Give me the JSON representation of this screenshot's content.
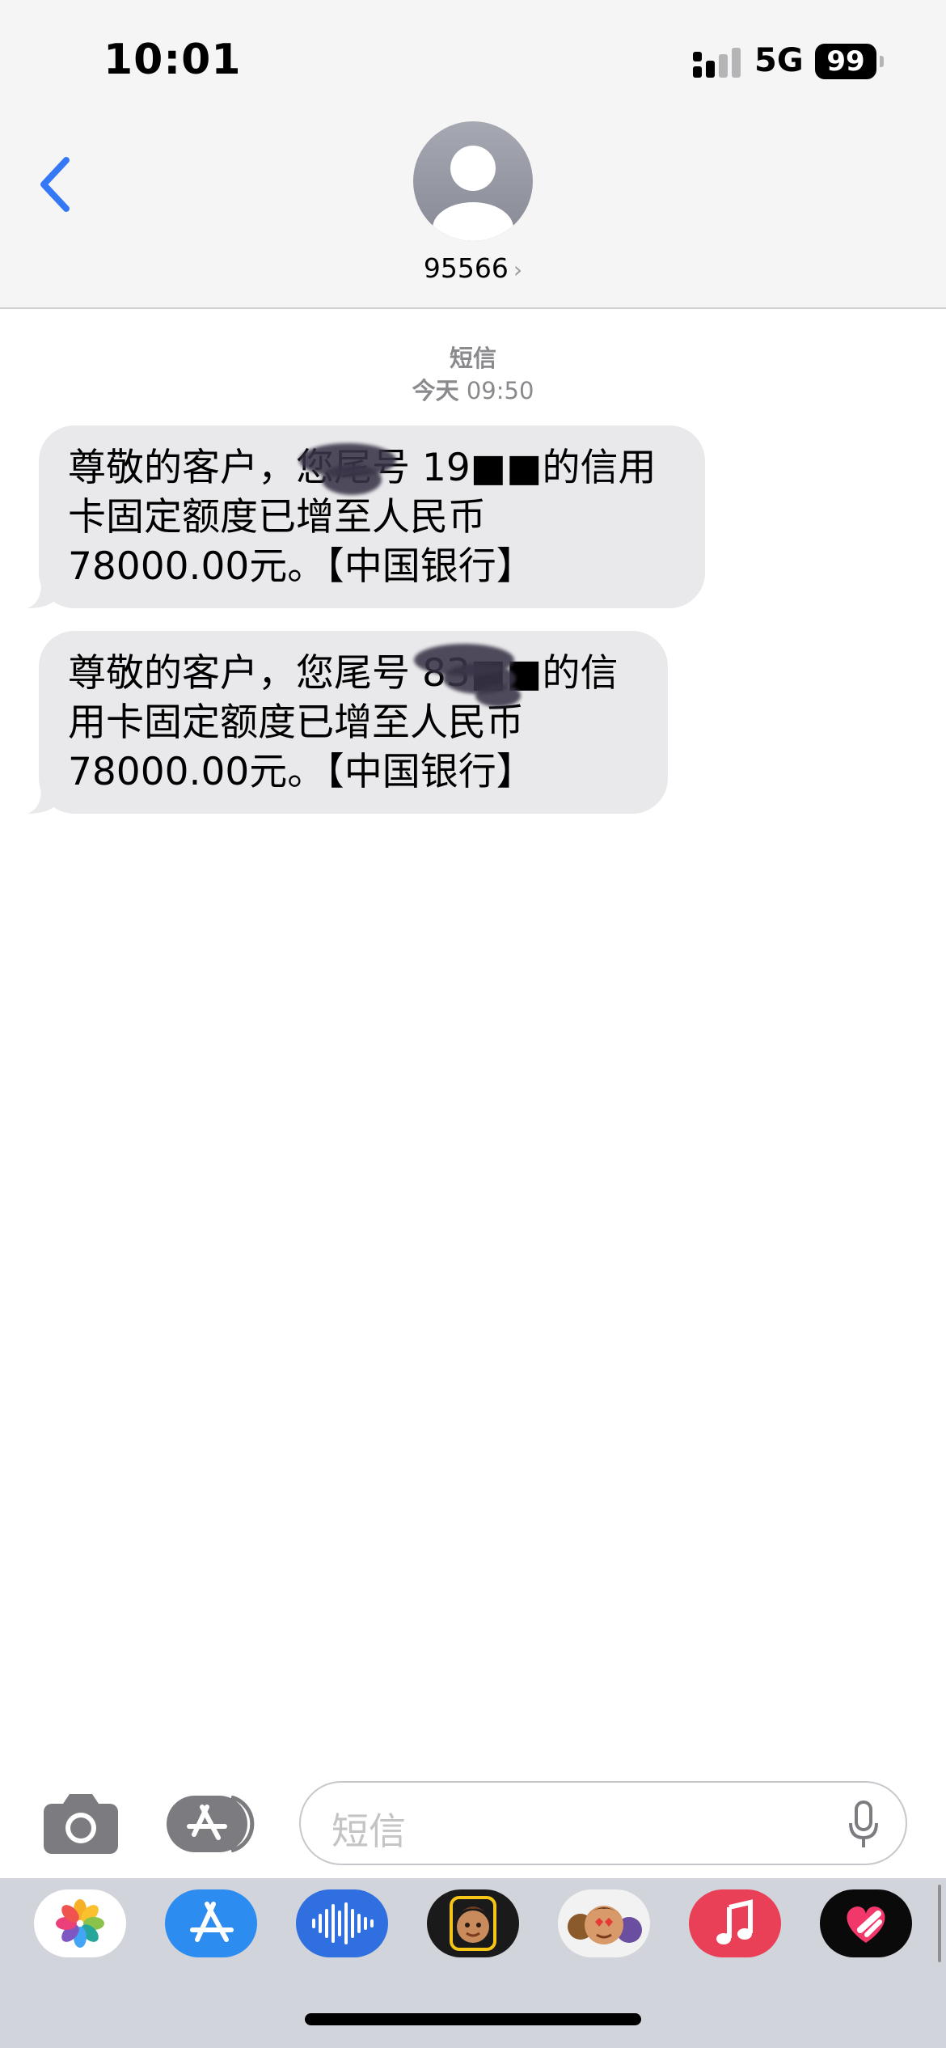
{
  "status_bar": {
    "time": "10:01",
    "network": "5G",
    "battery": "99"
  },
  "contact": {
    "name": "95566",
    "chevron": "›",
    "avatar_icon": "person-silhouette-icon"
  },
  "thread": {
    "service": "短信",
    "day": "今天",
    "time": "09:50"
  },
  "messages": [
    {
      "lines": [
        "尊敬的客户，您尾号 19■■的信用",
        "卡固定额度已增至人民币",
        "78000.00元。【中国银行】"
      ]
    },
    {
      "lines": [
        "尊敬的客户，您尾号 83■■的信",
        "用卡固定额度已增至人民币",
        "78000.00元。【中国银行】"
      ]
    }
  ],
  "compose": {
    "placeholder": "短信"
  },
  "app_drawer": [
    {
      "name": "photos",
      "icon": "photos-flower-icon"
    },
    {
      "name": "app-store",
      "icon": "app-store-icon"
    },
    {
      "name": "audio",
      "icon": "audio-waveform-icon"
    },
    {
      "name": "memoji",
      "icon": "memoji-face-icon"
    },
    {
      "name": "memoji-stickers",
      "icon": "memoji-stickers-icon"
    },
    {
      "name": "music",
      "icon": "music-note-icon"
    },
    {
      "name": "digital-touch",
      "icon": "heart-touch-icon"
    }
  ],
  "colors": {
    "header_bg": "#f5f5f6",
    "bubble_bg": "#e9e9eb",
    "accent_blue": "#3478f6",
    "drawer_bg": "#d1d4da"
  }
}
